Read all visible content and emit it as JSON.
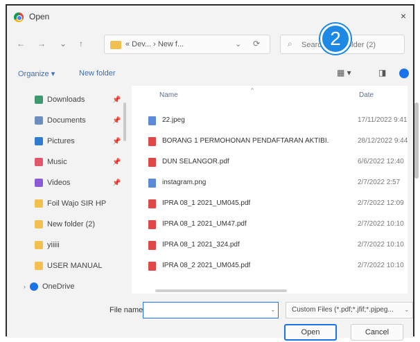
{
  "window": {
    "title": "Open",
    "close_glyph": "×"
  },
  "nav": {
    "back": "←",
    "forward": "→",
    "dropdown": "⌄",
    "up": "↑"
  },
  "address": {
    "breadcrumb": "« Dev... › New f...",
    "dropdown": "⌄",
    "refresh": "⟳"
  },
  "search": {
    "placeholder": "Search New folder (2)",
    "icon": "search-icon"
  },
  "badge": {
    "label": "2"
  },
  "toolbar": {
    "organize": "Organize ▾",
    "new_folder": "New folder",
    "view_glyph": "▦ ▾",
    "pane_glyph": "◨"
  },
  "nav_pane": {
    "items": [
      {
        "label": "Downloads",
        "color": "#3d9970",
        "pin": "📌"
      },
      {
        "label": "Documents",
        "color": "#6c8ebf",
        "pin": "📌"
      },
      {
        "label": "Pictures",
        "color": "#2e7bcf",
        "pin": "📌"
      },
      {
        "label": "Music",
        "color": "#e0566b",
        "pin": "📌"
      },
      {
        "label": "Videos",
        "color": "#8e5bd6",
        "pin": "📌"
      },
      {
        "label": "Foil Wajo SIR HP",
        "color": "#f2c04e",
        "pin": ""
      },
      {
        "label": "New folder (2)",
        "color": "#f2c04e",
        "pin": ""
      },
      {
        "label": "yiiiii",
        "color": "#f2c04e",
        "pin": ""
      },
      {
        "label": "USER MANUAL",
        "color": "#f2c04e",
        "pin": ""
      },
      {
        "label": "OneDrive",
        "color": "#1a73e8",
        "pin": ""
      }
    ]
  },
  "columns": {
    "name": "Name",
    "date": "Date",
    "sort": "^"
  },
  "files": [
    {
      "name": "22.jpeg",
      "date": "17/11/2022 9:41",
      "color": "#5b8bd6"
    },
    {
      "name": "BORANG 1 PERMOHONAN PENDAFTARAN AKTIBI...",
      "date": "28/12/2022 9:44",
      "color": "#e04848"
    },
    {
      "name": "DUN SELANGOR.pdf",
      "date": "6/6/2022 12:40",
      "color": "#e04848"
    },
    {
      "name": "instagram.png",
      "date": "2/7/2022 2:57",
      "color": "#5b8bd6"
    },
    {
      "name": "IPRA 08_1 2021_UM045.pdf",
      "date": "2/7/2022 12:09",
      "color": "#e04848"
    },
    {
      "name": "IPRA 08_1 2021_UM47.pdf",
      "date": "2/7/2022 10:10",
      "color": "#e04848"
    },
    {
      "name": "IPRA 08_1 2021_324.pdf",
      "date": "2/7/2022 10:10",
      "color": "#e04848"
    },
    {
      "name": "IPRA 08_2 2021_UM045.pdf",
      "date": "2/7/2022 10:10",
      "color": "#e04848"
    }
  ],
  "bottom": {
    "file_name_label": "File name:",
    "file_name_value": "",
    "file_type": "Custom Files (*.pdf;*.jfif;*.pjpeg...",
    "open": "Open",
    "cancel": "Cancel"
  },
  "colors": {
    "accent": "#1a73e8",
    "badge": "#1e88e5"
  }
}
